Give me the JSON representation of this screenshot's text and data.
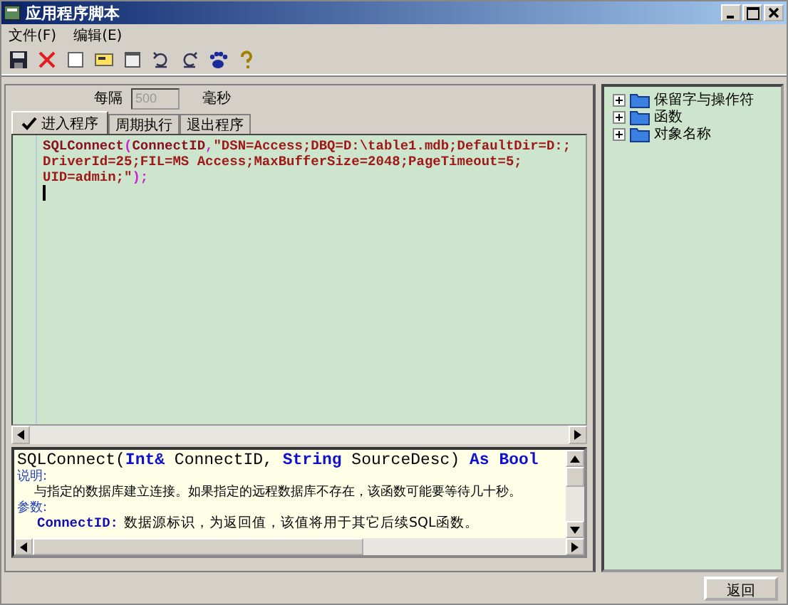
{
  "window": {
    "title": "应用程序脚本"
  },
  "menu": [
    "文件(F)",
    "编辑(E)"
  ],
  "interval": {
    "label": "每隔",
    "value": "500",
    "unit": "毫秒",
    "disabled": true
  },
  "tabs": [
    {
      "label": "进入程序",
      "selected": true
    },
    {
      "label": "周期执行",
      "selected": false
    },
    {
      "label": "退出程序",
      "selected": false
    }
  ],
  "code_lines": [
    [
      {
        "text": "SQLConnect",
        "kind": "name"
      },
      {
        "text": "(",
        "kind": "punct"
      },
      {
        "text": "ConnectID",
        "kind": "name"
      },
      {
        "text": ",",
        "kind": "punct"
      },
      {
        "text": "\"DSN=Access;DBQ=D:\\table1.mdb;DefaultDir=D:;",
        "kind": "string"
      }
    ],
    [
      {
        "text": "DriverId=25;FIL=MS Access;MaxBufferSize=2048;PageTimeout=5;",
        "kind": "string"
      }
    ],
    [
      {
        "text": "UID=admin;\"",
        "kind": "string"
      },
      {
        "text": ");",
        "kind": "punct"
      }
    ]
  ],
  "help": {
    "signature": [
      {
        "text": "SQLConnect(",
        "kind": "plain"
      },
      {
        "text": "Int&",
        "kind": "keyword"
      },
      {
        "text": " ConnectID, ",
        "kind": "plain"
      },
      {
        "text": "String",
        "kind": "keyword"
      },
      {
        "text": " SourceDesc) ",
        "kind": "plain"
      },
      {
        "text": "As Bool",
        "kind": "keyword"
      }
    ],
    "description_label": "说明:",
    "description": "与指定的数据库建立连接。如果指定的远程数据库不存在，该函数可能要等待几十秒。",
    "params_label": "参数:",
    "params": [
      {
        "name": "ConnectID:",
        "text": "数据源标识，为返回值，该值将用于其它后续SQL函数。"
      }
    ]
  },
  "tree": [
    {
      "label": "保留字与操作符",
      "expanded": false
    },
    {
      "label": "函数",
      "expanded": false
    },
    {
      "label": "对象名称",
      "expanded": false
    }
  ],
  "buttons": [
    "返回"
  ]
}
